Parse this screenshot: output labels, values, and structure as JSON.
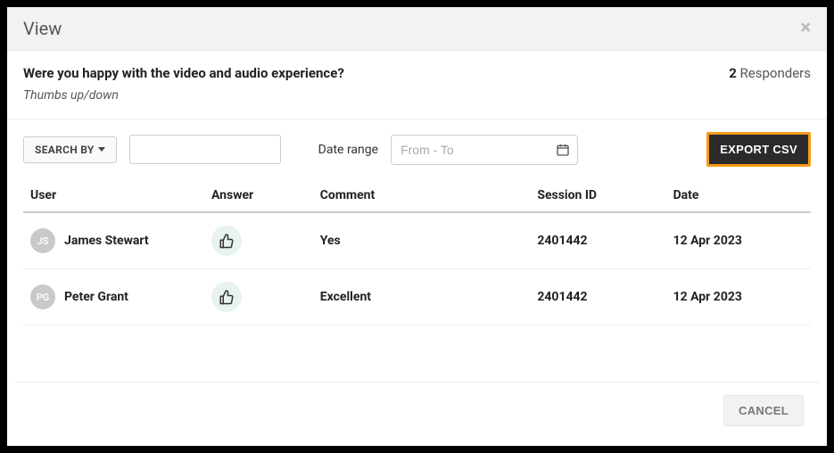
{
  "header": {
    "title": "View"
  },
  "question": "Were you happy with the video and audio experience?",
  "subtitle": "Thumbs up/down",
  "responders": {
    "count": "2",
    "label": "Responders"
  },
  "toolbar": {
    "searchByLabel": "SEARCH BY",
    "dateRangeLabel": "Date range",
    "dateRangePlaceholder": "From - To",
    "exportLabel": "EXPORT CSV"
  },
  "table": {
    "headers": {
      "user": "User",
      "answer": "Answer",
      "comment": "Comment",
      "session": "Session ID",
      "date": "Date"
    },
    "rows": [
      {
        "initials": "JS",
        "name": "James Stewart",
        "answer": "thumbs-up",
        "comment": "Yes",
        "session": "2401442",
        "date": "12 Apr 2023"
      },
      {
        "initials": "PG",
        "name": "Peter Grant",
        "answer": "thumbs-up",
        "comment": "Excellent",
        "session": "2401442",
        "date": "12 Apr 2023"
      }
    ]
  },
  "footer": {
    "cancel": "CANCEL"
  }
}
